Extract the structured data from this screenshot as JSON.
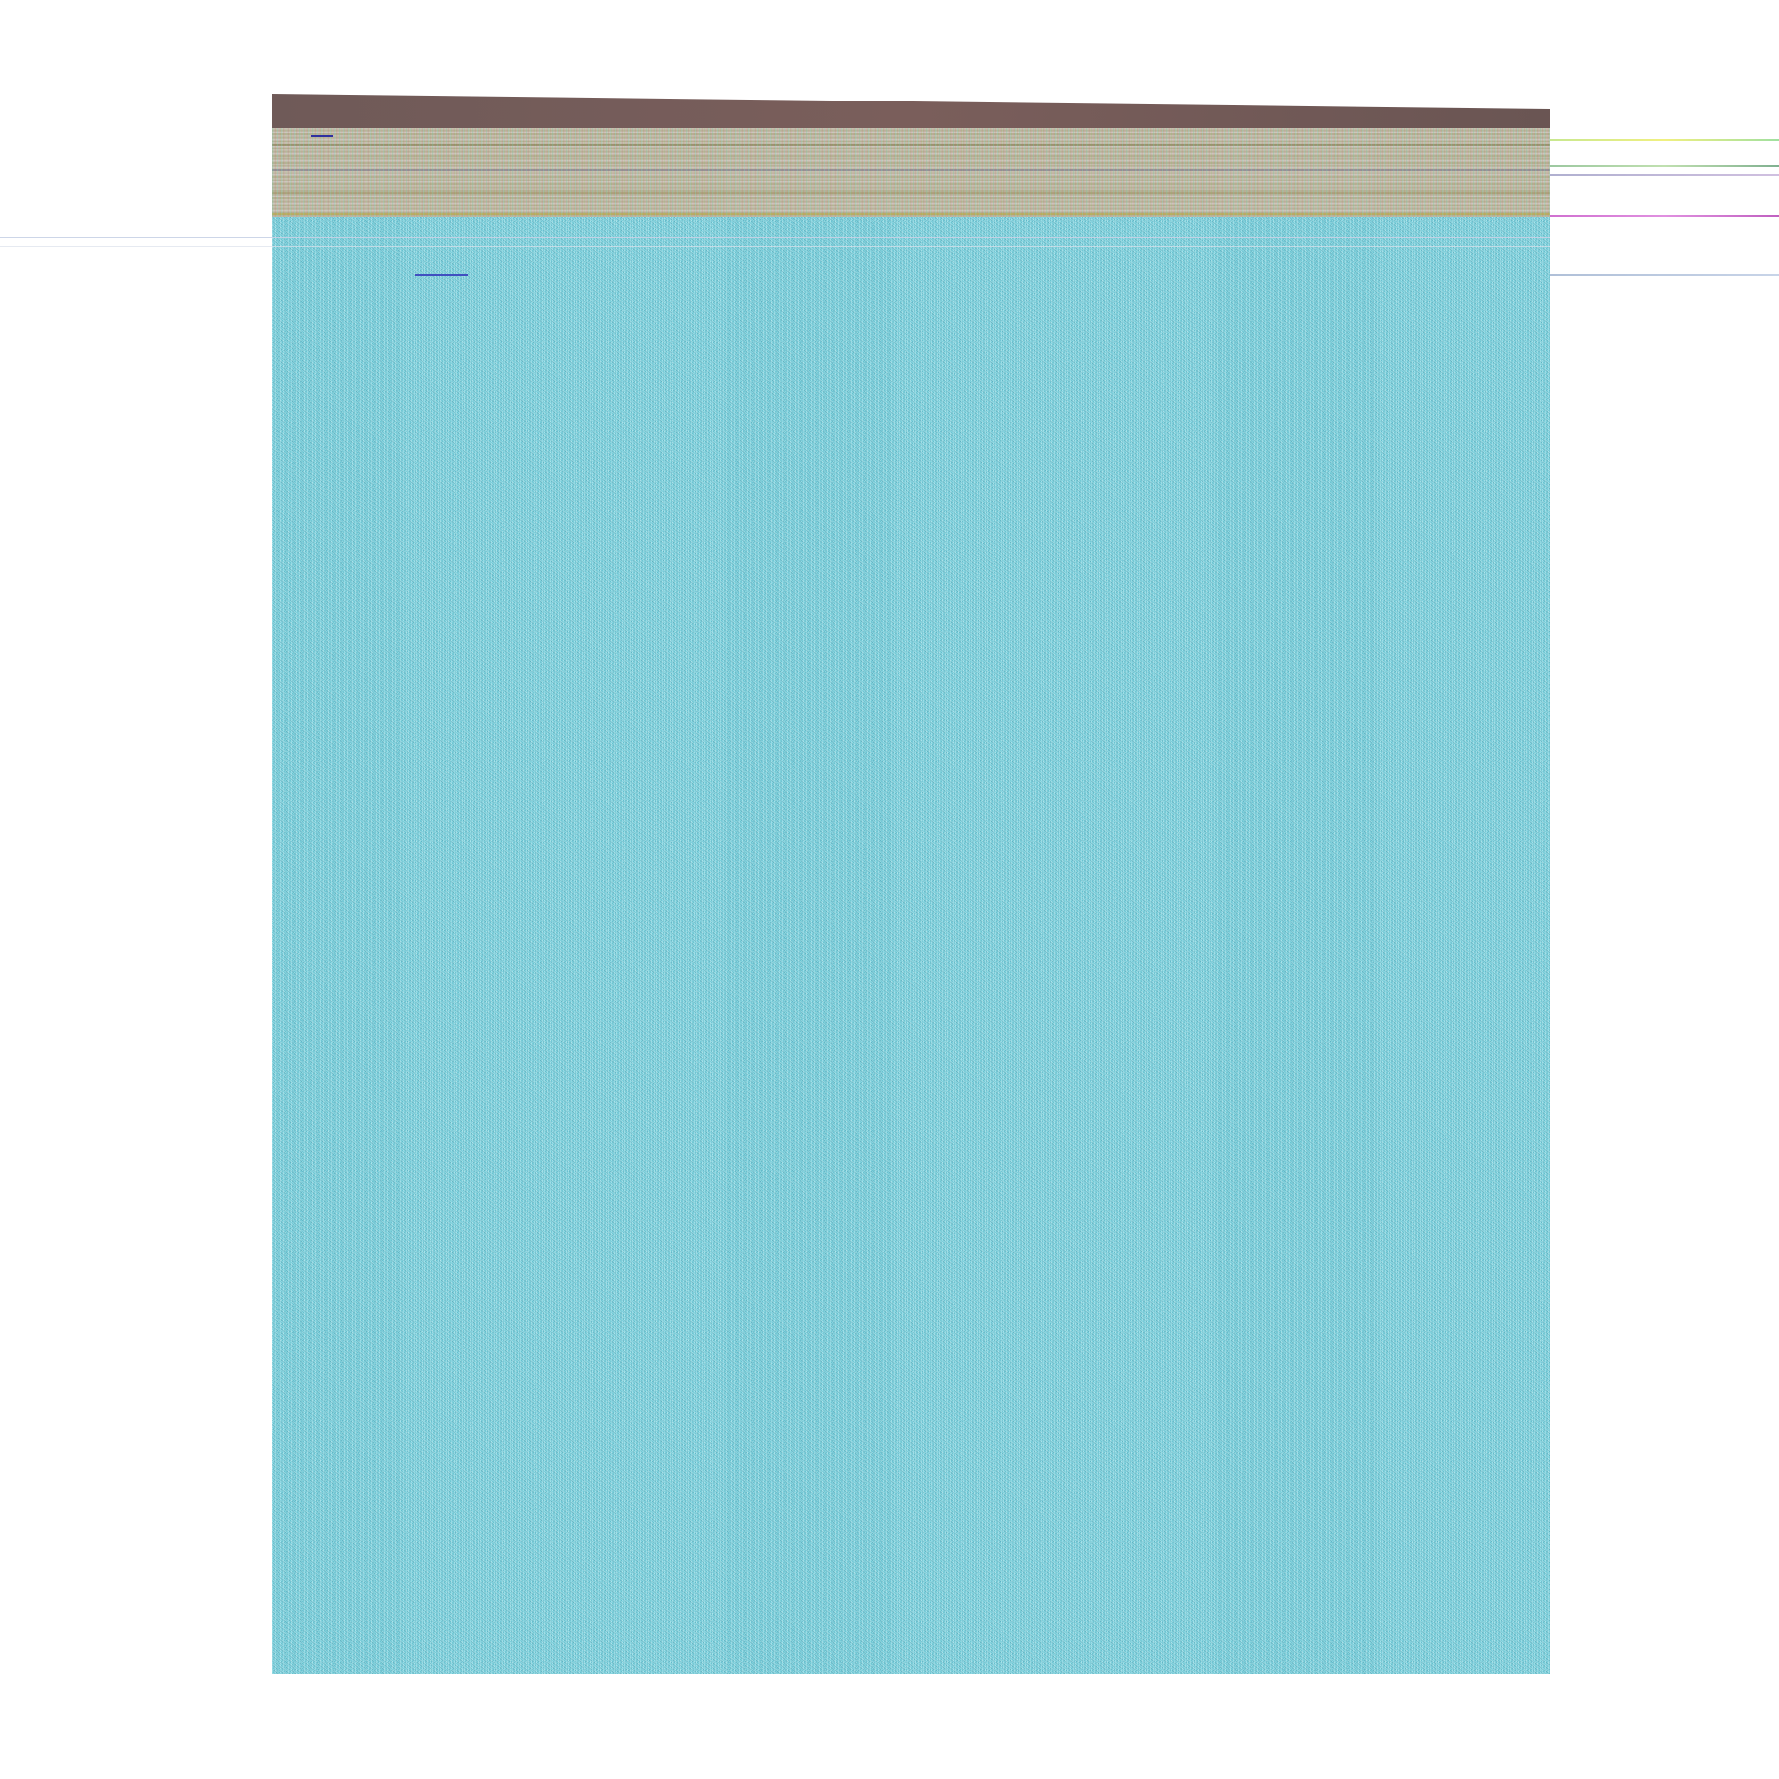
{
  "window": {
    "title": ""
  },
  "colors": {
    "title_bar": "#6f5a58",
    "toolbar_noise": "#d4d0a8",
    "content_noise": "#5fd6de",
    "page_background": "#ffffff"
  }
}
